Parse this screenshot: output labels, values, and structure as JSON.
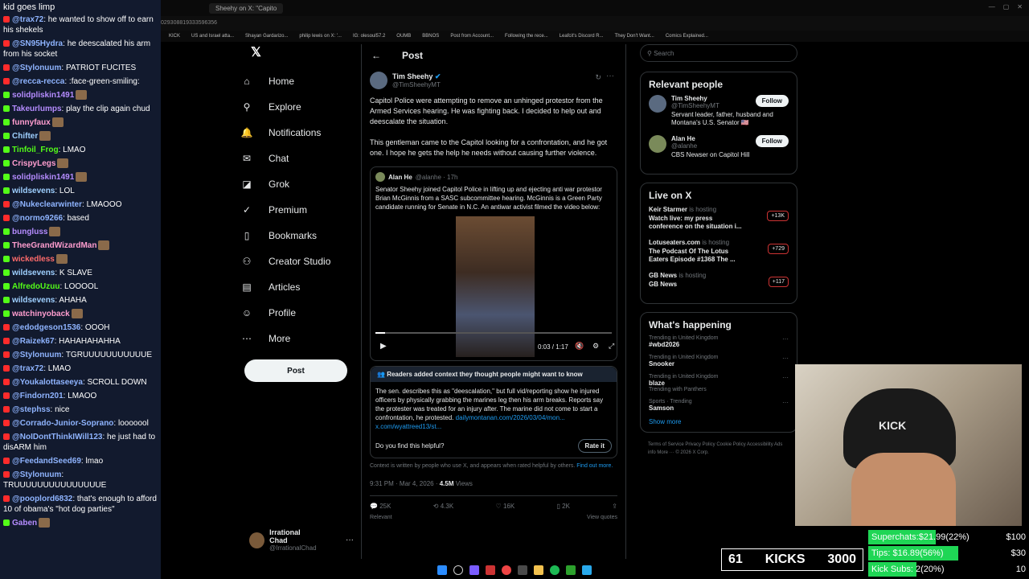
{
  "chat": {
    "title": "kid goes limp",
    "messages": [
      {
        "platform": "yt",
        "user": "@trax72",
        "text": "he wanted to show off to earn his shekels",
        "color": "#8fb4ff"
      },
      {
        "platform": "yt",
        "user": "@SN95Hydra",
        "text": "he deescalated his arm from his socket",
        "color": "#8fb4ff"
      },
      {
        "platform": "yt",
        "user": "@Stylonuum",
        "text": "PATRIOT FUCITES",
        "color": "#8fb4ff"
      },
      {
        "platform": "yt",
        "user": "@recca-recca",
        "text": ":face-green-smiling:",
        "color": "#8fb4ff"
      },
      {
        "platform": "kick",
        "user": "solidpliskin1491",
        "text": "",
        "color": "#b58cff"
      },
      {
        "platform": "kick",
        "user": "Takeurlumps",
        "text": "play the clip again chud",
        "color": "#b58cff"
      },
      {
        "platform": "kick",
        "user": "funnyfaux",
        "text": "",
        "color": "#ff9dcf"
      },
      {
        "platform": "kick",
        "user": "Chifter",
        "text": "",
        "color": "#9fd0ff"
      },
      {
        "platform": "kick",
        "user": "Tinfoil_Frog",
        "text": "LMAO",
        "color": "#53fc18"
      },
      {
        "platform": "kick",
        "user": "CrispyLegs",
        "text": "",
        "color": "#ff9dcf"
      },
      {
        "platform": "kick",
        "user": "solidpliskin1491",
        "text": "",
        "color": "#b58cff"
      },
      {
        "platform": "kick",
        "user": "wildsevens",
        "text": "LOL",
        "color": "#9fd0ff"
      },
      {
        "platform": "yt",
        "user": "@Nukeclearwinter",
        "text": "LMAOOO",
        "color": "#8fb4ff"
      },
      {
        "platform": "yt",
        "user": "@normo9266",
        "text": "based",
        "color": "#8fb4ff"
      },
      {
        "platform": "kick",
        "user": "bungluss",
        "text": "",
        "color": "#b58cff"
      },
      {
        "platform": "kick",
        "user": "TheeGrandWizardMan",
        "text": "",
        "color": "#ff9dcf"
      },
      {
        "platform": "kick",
        "user": "wickedless",
        "text": "",
        "color": "#ff6b6b"
      },
      {
        "platform": "kick",
        "user": "wildsevens",
        "text": "K SLAVE",
        "color": "#9fd0ff"
      },
      {
        "platform": "kick",
        "user": "AlfredoUzuu",
        "text": "LOOOOL",
        "color": "#53fc18"
      },
      {
        "platform": "kick",
        "user": "wildsevens",
        "text": "AHAHA",
        "color": "#9fd0ff"
      },
      {
        "platform": "kick",
        "user": "watchinyoback",
        "text": "",
        "color": "#ff9dcf"
      },
      {
        "platform": "yt",
        "user": "@edodgeson1536",
        "text": "OOOH",
        "color": "#8fb4ff"
      },
      {
        "platform": "yt",
        "user": "@Raizek67",
        "text": "HAHAHAHAHHA",
        "color": "#8fb4ff"
      },
      {
        "platform": "yt",
        "user": "@Stylonuum",
        "text": "TGRUUUUUUUUUUUE",
        "color": "#8fb4ff"
      },
      {
        "platform": "yt",
        "user": "@trax72",
        "text": "LMAO",
        "color": "#8fb4ff"
      },
      {
        "platform": "yt",
        "user": "@Youkalottaseeya",
        "text": "SCROLL DOWN",
        "color": "#8fb4ff"
      },
      {
        "platform": "yt",
        "user": "@Findorn201",
        "text": "LMAOO",
        "color": "#8fb4ff"
      },
      {
        "platform": "yt",
        "user": "@stephss",
        "text": "nice",
        "color": "#8fb4ff"
      },
      {
        "platform": "yt",
        "user": "@Corrado-Junior-Soprano",
        "text": "looooool",
        "color": "#8fb4ff"
      },
      {
        "platform": "yt",
        "user": "@NoIDontThinkIWill123",
        "text": "he just had to disARM him",
        "color": "#8fb4ff"
      },
      {
        "platform": "yt",
        "user": "@FeedandSeed69",
        "text": "lmao",
        "color": "#8fb4ff"
      },
      {
        "platform": "yt",
        "user": "@Stylonuum",
        "text": "TRUUUUUUUUUUUUUUUE",
        "color": "#8fb4ff"
      },
      {
        "platform": "yt",
        "user": "@pooplord6832",
        "text": "that's enough to afford 10 of obama's \"hot dog parties\"",
        "color": "#8fb4ff"
      },
      {
        "platform": "kick",
        "user": "Gaben",
        "text": "",
        "color": "#b58cff"
      }
    ]
  },
  "browser": {
    "tab_title": "Sheehy on X: \"Capito",
    "url": "029308819333596356",
    "bookmarks": [
      "KICK",
      "US and Israel atta...",
      "Shayan Gardarizo...",
      "philip lewis on X: '...",
      "IG: olesoul57.2",
      "OUMB",
      "BBNOS",
      "Post from Account...",
      "Following the rece...",
      "Leafcit's Discord R...",
      "They Don't Want...",
      "Comics Explained..."
    ]
  },
  "nav": {
    "items": [
      {
        "label": "Home",
        "icon": "home-icon",
        "glyph": "⌂"
      },
      {
        "label": "Explore",
        "icon": "search-icon",
        "glyph": "⚲"
      },
      {
        "label": "Notifications",
        "icon": "bell-icon",
        "glyph": "🔔"
      },
      {
        "label": "Chat",
        "icon": "mail-icon",
        "glyph": "✉"
      },
      {
        "label": "Grok",
        "icon": "grok-icon",
        "glyph": "◪"
      },
      {
        "label": "Premium",
        "icon": "premium-icon",
        "glyph": "✓"
      },
      {
        "label": "Bookmarks",
        "icon": "bookmark-icon",
        "glyph": "▯"
      },
      {
        "label": "Creator Studio",
        "icon": "creator-icon",
        "glyph": "⚇"
      },
      {
        "label": "Articles",
        "icon": "articles-icon",
        "glyph": "▤"
      },
      {
        "label": "Profile",
        "icon": "profile-icon",
        "glyph": "☺"
      },
      {
        "label": "More",
        "icon": "more-icon",
        "glyph": "⋯"
      }
    ],
    "post_button": "Post",
    "account_name": "Irrational Chad",
    "account_handle": "@IrrationalChad"
  },
  "post": {
    "header": "Post",
    "author": "Tim Sheehy",
    "handle": "@TimSheehyMT",
    "text1": "Capitol Police were attempting to remove an unhinged protestor from the Armed Services hearing. He was fighting back. I decided to help out and deescalate the situation.",
    "text2": "This gentleman came to the Capitol looking for a confrontation, and he got one. I hope he gets the help he needs without causing further violence.",
    "quote_author": "Alan He",
    "quote_handle": "@alanhe · 17h",
    "quote_text": "Senator Sheehy joined Capitol Police in lifting up and ejecting anti war protestor Brian McGinnis from a SASC subcommittee hearing.  McGinnis is a Green Party candidate running for Senate in N.C. An antiwar activist filmed the video below:",
    "video_time": "0:03 / 1:17",
    "video_progress": 0.04,
    "note_header": "Readers added context they thought people might want to know",
    "note_text": "The sen. describes this as \"deescalation,\" but full vid/reporting show he injured officers by physically grabbing the marines leg then his arm breaks. Reports say the protester was treated for an injury after. The marine did not come to start a confrontation, he protested.",
    "note_links": "dailymontanan.com/2026/03/04/mon...  x.com/wyattreed13/st...",
    "helpful_q": "Do you find this helpful?",
    "rate_it": "Rate it",
    "context_footer": "Context is written by people who use X, and appears when rated helpful by others.",
    "find_out_more": "Find out more.",
    "timestamp": "9:31 PM · Mar 4, 2026 · ",
    "views": "4.5M",
    "views_label": " Views",
    "replies": "25K",
    "reposts": "4.3K",
    "likes": "16K",
    "bookmarks": "2K",
    "relevant": "Relevant",
    "view_quotes": "View quotes"
  },
  "sidebar": {
    "search_placeholder": "Search",
    "relevant_title": "Relevant people",
    "people": [
      {
        "name": "Tim Sheehy",
        "handle": "@TimSheehyMT",
        "bio": "Servant leader, father, husband and Montana's U.S. Senator 🇺🇸",
        "follow": "Follow"
      },
      {
        "name": "Alan He",
        "handle": "@alanhe",
        "bio": "CBS Newser on Capitol Hill",
        "follow": "Follow"
      }
    ],
    "live_title": "Live on X",
    "live": [
      {
        "host": "Keir Starmer",
        "status": "is hosting",
        "title": "Watch live: my press conference on the situation i...",
        "count": "+13K"
      },
      {
        "host": "Lotuseaters.com",
        "status": "is hosting",
        "title": "The Podcast Of The Lotus Eaters Episode #1368 The ...",
        "count": "+729"
      },
      {
        "host": "GB News",
        "status": "is hosting",
        "title": "GB News",
        "count": "+117"
      }
    ],
    "happening_title": "What's happening",
    "trends": [
      {
        "context": "Trending in United Kingdom",
        "name": "#wbd2026",
        "extra": ""
      },
      {
        "context": "Trending in United Kingdom",
        "name": "Snooker",
        "extra": ""
      },
      {
        "context": "Trending in United Kingdom",
        "name": "blaze",
        "extra": "Trending with Panthers"
      },
      {
        "context": "Sports · Trending",
        "name": "Samson",
        "extra": ""
      }
    ],
    "show_more": "Show more",
    "footer": "Terms of Service   Privacy Policy   Cookie Policy   Accessibility   Ads info   More ···   © 2026 X Corp."
  },
  "stream": {
    "kicks_count": "61",
    "kicks_label": "KICKS",
    "kicks_goal": "3000",
    "superchats_label": "Superchats:",
    "superchats_value": "$21.99(22%)",
    "superchats_goal": "$100",
    "superchats_pct": 0.22,
    "tips_label": "Tips:",
    "tips_value": "$16.89(56%)",
    "tips_goal": "$30",
    "tips_pct": 0.56,
    "subs_label": "Kick Subs:",
    "subs_value": "2(20%)",
    "subs_goal": "10",
    "subs_pct": 0.2,
    "cap_text": "KICK"
  }
}
